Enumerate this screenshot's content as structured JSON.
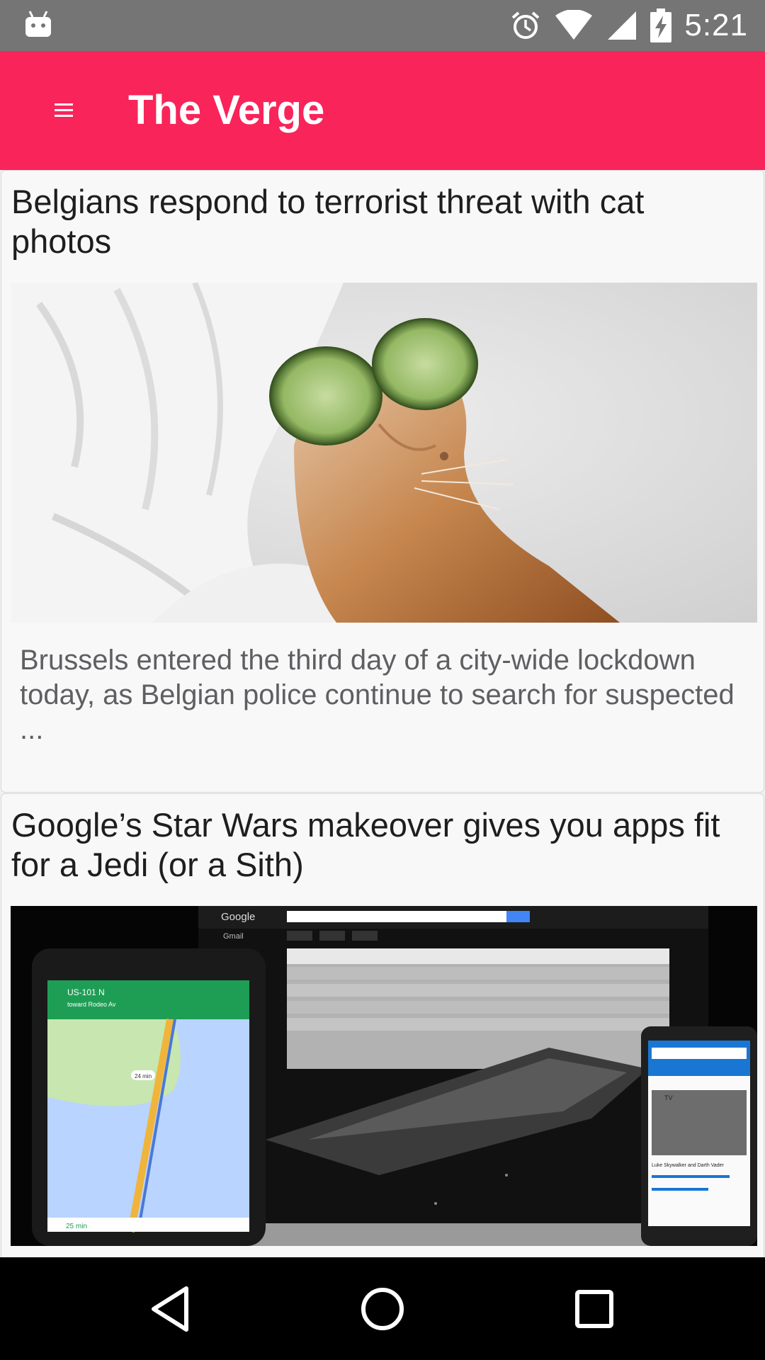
{
  "status_bar": {
    "time": "5:21",
    "left_icon": "android-debug-icon",
    "icons": [
      "alarm-icon",
      "wifi-icon",
      "signal-icon",
      "battery-charging-icon"
    ]
  },
  "app_bar": {
    "title": "The Verge",
    "menu_icon": "hamburger-menu-icon",
    "color": "#f8245a"
  },
  "articles": [
    {
      "title": " Belgians respond to terrorist threat with cat photos",
      "image": "cat-with-cucumbers-photo",
      "description": " Brussels entered the third day of a city-wide lockdown today, as Belgian police continue to search for suspected ..."
    },
    {
      "title": " Google’s Star Wars makeover gives you apps fit for a Jedi (or a Sith)",
      "image": "star-wars-google-apps-photo",
      "image_text": {
        "google_logo": "Google",
        "gmail_label": "Gmail",
        "maps_route": "US-101 N",
        "maps_toward": "toward Rodeo Av",
        "maps_eta": "25 min",
        "maps_chip": "24 min",
        "phone_card_tag": "TV",
        "phone_card_title": "Luke Skywalker and Darth Vader"
      }
    }
  ],
  "nav_bar": {
    "icons": [
      "back-icon",
      "home-icon",
      "recents-icon"
    ]
  }
}
